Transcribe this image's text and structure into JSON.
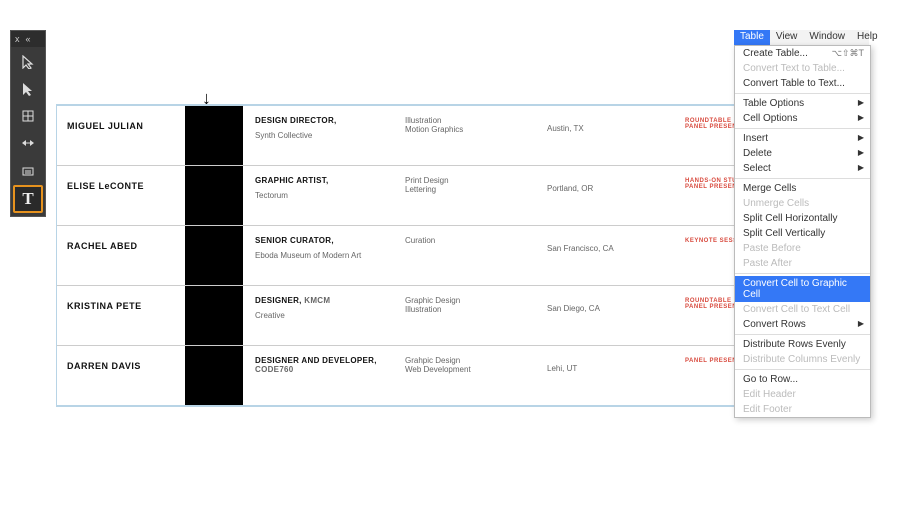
{
  "tool_panel": {
    "close": "x",
    "collapse": "«",
    "type_tool": "T"
  },
  "arrow_glyph": "↓",
  "table": {
    "rows": [
      {
        "name": "MIGUEL JULIAN",
        "role_bold": "DESIGN DIRECTOR,",
        "role_text": "Synth Collective",
        "sk1": "Illustration",
        "sk2": "Motion Graphics",
        "loc": "Austin, TX",
        "tag1": "ROUNDTABLE",
        "tag2": "PANEL PRESENTATION"
      },
      {
        "name": "ELISE LeCONTE",
        "role_bold": "GRAPHIC ARTIST,",
        "role_text": "Tectorum",
        "sk1": "Print Design",
        "sk2": "Lettering",
        "loc": "Portland, OR",
        "tag1": "HANDS-ON STUDIO",
        "tag2": "PANEL PRESENTATION"
      },
      {
        "name": "RACHEL ABED",
        "role_bold": "SENIOR CURATOR,",
        "role_text": "Eboda Museum of Modern Art",
        "sk1": "Curation",
        "sk2": "",
        "loc": "San Francisco, CA",
        "tag1": "KEYNOTE SESSION",
        "tag2": ""
      },
      {
        "name": "KRISTINA PETE",
        "role_bold": "DESIGNER,",
        "role_suffix": " KMCM",
        "role_text": "Creative",
        "sk1": "Graphic Design",
        "sk2": "Illustration",
        "loc": "San Diego, CA",
        "tag1": "ROUNDTABLE",
        "tag2": "PANEL PRESENTATION"
      },
      {
        "name": "DARREN DAVIS",
        "role_bold": "DESIGNER AND DEVELOPER,",
        "role_suffix": " CODE760",
        "role_text": "",
        "sk1": "Grahpic Design",
        "sk2": "Web Development",
        "loc": "Lehi, UT",
        "tag1": "PANEL PRESENTATION",
        "tag2": ""
      }
    ]
  },
  "menubar": {
    "table": "Table",
    "view": "View",
    "window": "Window",
    "help": "Help"
  },
  "menu": {
    "create": "Create Table...",
    "create_sc": "⌥⇧⌘T",
    "conv_to_table": "Convert Text to Table...",
    "conv_to_text": "Convert Table to Text...",
    "table_opts": "Table Options",
    "cell_opts": "Cell Options",
    "insert": "Insert",
    "delete": "Delete",
    "select": "Select",
    "merge": "Merge Cells",
    "unmerge": "Unmerge Cells",
    "split_h": "Split Cell Horizontally",
    "split_v": "Split Cell Vertically",
    "paste_before": "Paste Before",
    "paste_after": "Paste After",
    "conv_graphic": "Convert Cell to Graphic Cell",
    "conv_text": "Convert Cell to Text Cell",
    "conv_rows": "Convert Rows",
    "dist_rows": "Distribute Rows Evenly",
    "dist_cols": "Distribute Columns Evenly",
    "goto": "Go to Row...",
    "edit_header": "Edit Header",
    "edit_footer": "Edit Footer"
  }
}
